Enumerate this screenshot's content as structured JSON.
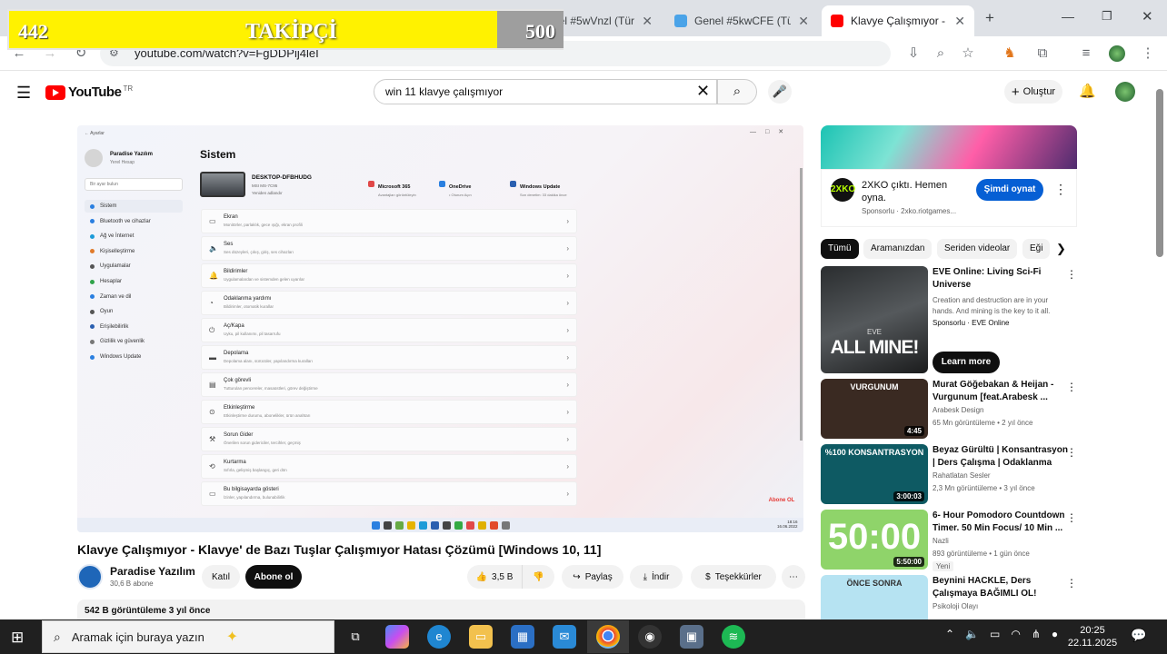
{
  "browser": {
    "tabs": [
      {
        "label": "Genel #5wVnzl (Türk",
        "close": "✕"
      },
      {
        "label": "Genel #5kwCFE (Türk",
        "close": "✕"
      },
      {
        "label": "Klavye Çalışmıyor - K",
        "close": "✕"
      }
    ],
    "new_tab": "+",
    "url": "youtube.com/watch?v=FgDDPij4leI"
  },
  "follower_widget": {
    "current": "442",
    "label": "TAKİPÇİ",
    "goal": "500"
  },
  "youtube": {
    "logo_text": "YouTube",
    "logo_country": "TR",
    "search_value": "win 11 klavye çalışmıyor",
    "create_label": "Oluştur"
  },
  "player": {
    "app_name": "Ayarlar",
    "user_name": "Paradise Yazılım",
    "user_sub": "Yerel Hesap",
    "search_placeholder": "Bir ayar bulun",
    "page_title": "Sistem",
    "device_name": "DESKTOP-DFBHUDG",
    "device_sub": "MSI MS-7C95",
    "device_rename": "Yeniden adlandır",
    "quick": [
      {
        "t": "Microsoft 365",
        "s": "Avantajları görüntüleyin"
      },
      {
        "t": "OneDrive",
        "s": "• Oturum Açın"
      },
      {
        "t": "Windows Update",
        "s": "Son denetim: 33 dakika önce"
      }
    ],
    "nav": [
      "Sistem",
      "Bluetooth ve cihazlar",
      "Ağ ve İnternet",
      "Kişiselleştirme",
      "Uygulamalar",
      "Hesaplar",
      "Zaman ve dil",
      "Oyun",
      "Erişilebilirlik",
      "Gizlilik ve güvenlik",
      "Windows Update"
    ],
    "rows": [
      {
        "t": "Ekran",
        "s": "Monitörler, parlaklık, gece ışığı, ekran profili"
      },
      {
        "t": "Ses",
        "s": "Ses düzeyleri, çıkış, giriş, ses cihazları"
      },
      {
        "t": "Bildirimler",
        "s": "Uygulamalardan ve sistemden gelen uyarılar"
      },
      {
        "t": "Odaklanma yardımı",
        "s": "Bildirimler, otomatik kurallar"
      },
      {
        "t": "Aç/Kapa",
        "s": "Uyku, pil kullanımı, pil tasarrufu"
      },
      {
        "t": "Depolama",
        "s": "Depolama alanı, sürücüler, yapılandırma kuralları"
      },
      {
        "t": "Çok görevli",
        "s": "Tutturulan pencereler, masaüstleri, görev değiştirme"
      },
      {
        "t": "Etkinleştirme",
        "s": "Etkinleştirme durumu, abonelikler, ürün anahtarı"
      },
      {
        "t": "Sorun Gider",
        "s": "Önerilen sorun gidericiler, tercihler, geçmiş"
      },
      {
        "t": "Kurtarma",
        "s": "Sıfırla, gelişmiş başlangıç, geri dön"
      },
      {
        "t": "Bu bilgisayarda gösteri",
        "s": "İzinler, yapılandırma, bulunabilirlik"
      }
    ],
    "watermark": "Abone OL",
    "tray_time": "18:16",
    "tray_date": "16.06.2022"
  },
  "video": {
    "title": "Klavye Çalışmıyor - Klavye' de Bazı Tuşlar Çalışmıyor Hatası Çözümü [Windows 10, 11]",
    "channel": "Paradise Yazılım",
    "subscribers": "30,6 B abone",
    "join": "Katıl",
    "subscribe": "Abone ol",
    "likes": "3,5 B",
    "share": "Paylaş",
    "download": "İndir",
    "thanks": "Teşekkürler",
    "more": "⋯",
    "views_age": "542 B görüntüleme  3 yıl önce"
  },
  "ad": {
    "logo_text": "2XKO",
    "title": "2XKO çıktı. Hemen oyna.",
    "sponsor": "Sponsorlu · 2xko.riotgames...",
    "cta": "Şimdi oynat"
  },
  "chips": [
    "Tümü",
    "Aramanızdan",
    "Seriden videolar",
    "Eği"
  ],
  "eve_ad": {
    "thumb_small": "EVE",
    "thumb_big": "ALL MINE!",
    "title": "EVE Online: Living Sci-Fi Universe",
    "desc": "Creation and destruction are in your hands. And mining is the key to it all.",
    "sponsor": "Sponsorlu · EVE Online",
    "cta": "Learn more"
  },
  "recommendations": [
    {
      "title": "Murat Göğebakan & Heijan - Vurgunum [feat.Arabesk ...",
      "channel": "Arabesk Design",
      "meta": "65 Mn görüntüleme • 2 yıl önce",
      "duration": "4:45",
      "thumb_text": "VURGUNUM",
      "thumb_color": "#3a2a22"
    },
    {
      "title": "Beyaz Gürültü | Konsantrasyon | Ders Çalışma | Odaklanma",
      "channel": "Rahatlatan Sesler",
      "meta": "2,3 Mn görüntüleme • 3 yıl önce",
      "duration": "3:00:03",
      "thumb_text": "%100 KONSANTRASYON",
      "thumb_color": "#0e5a63"
    },
    {
      "title": "6- Hour Pomodoro Countdown Timer. 50 Min Focus/ 10 Min ...",
      "channel": "Nazli",
      "meta": "893 görüntüleme • 1 gün önce",
      "badge": "Yeni",
      "duration": "5:50:00",
      "thumb_text": "50:00",
      "thumb_color": "#8fd46a"
    },
    {
      "title": "Beynini HACKLE, Ders Çalışmaya BAĞIMLI OL!",
      "channel": "Psikoloji Olayı",
      "meta": "",
      "duration": "",
      "thumb_text": "ÖNCE  SONRA",
      "thumb_color": "#b6e3f2"
    }
  ],
  "windows": {
    "search_placeholder": "Aramak için buraya yazın",
    "time": "20:25",
    "date": "22.11.2025"
  },
  "colors": {
    "yt_red": "#ff0000",
    "follow_yellow": "#fff200",
    "cta_blue": "#065fd4"
  }
}
